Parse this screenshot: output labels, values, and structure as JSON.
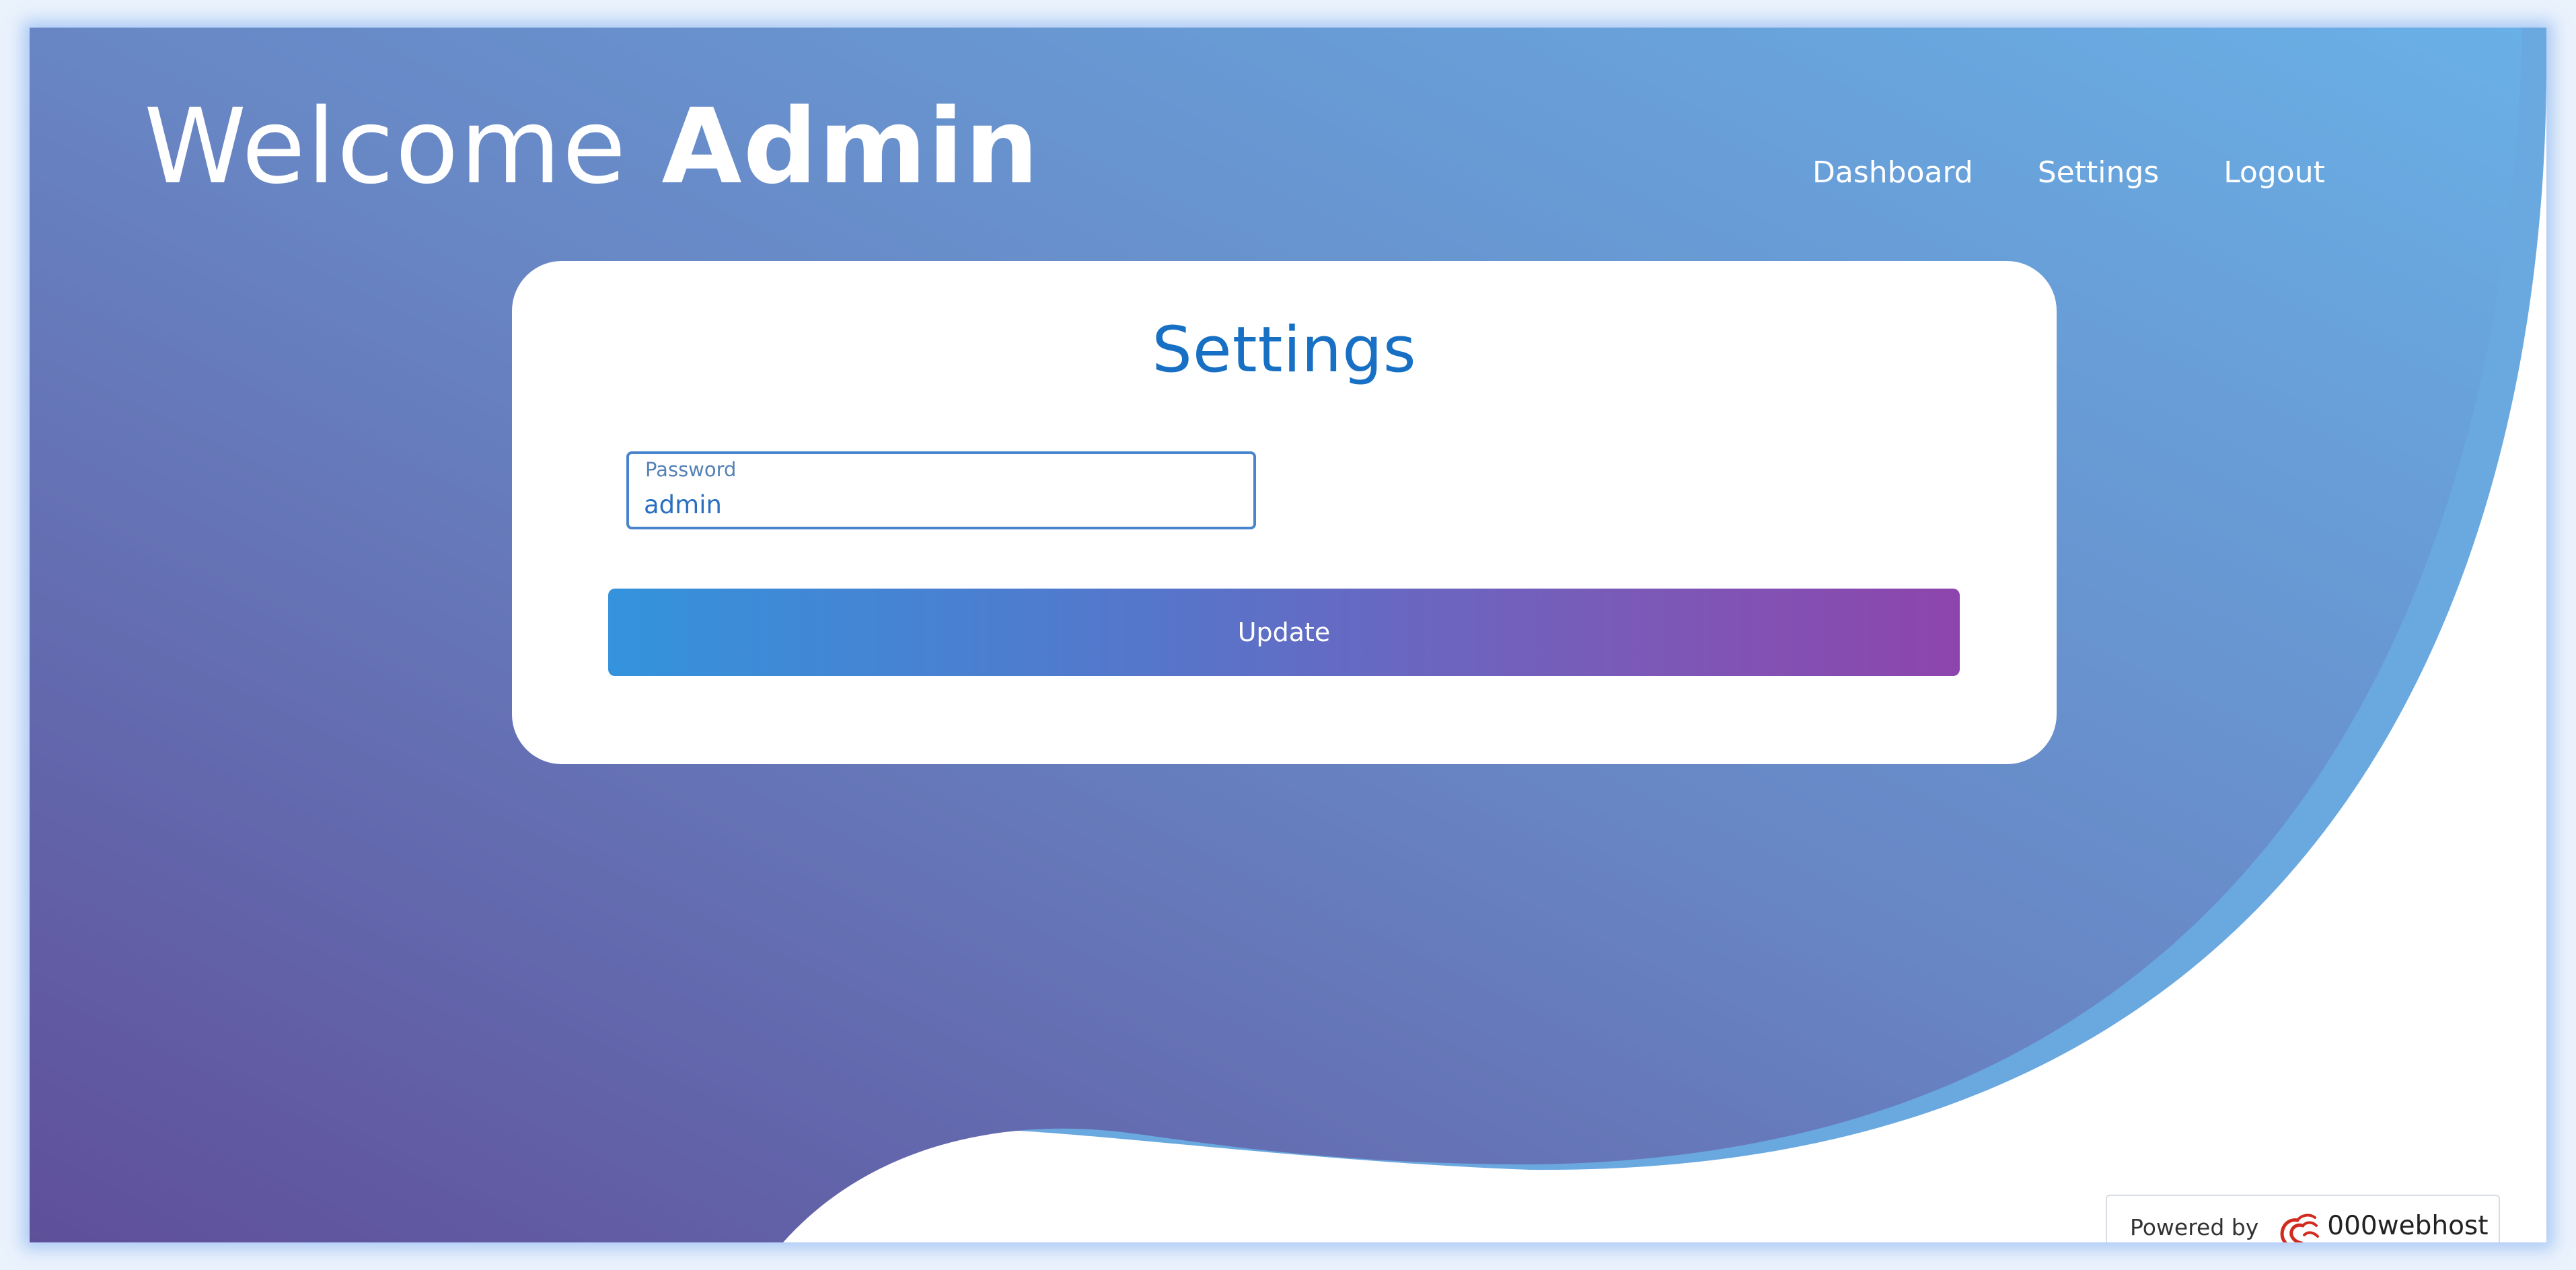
{
  "header": {
    "welcome_prefix": "Welcome",
    "welcome_name": "Admin"
  },
  "nav": {
    "dashboard": "Dashboard",
    "settings": "Settings",
    "logout": "Logout"
  },
  "settings_card": {
    "title": "Settings",
    "password_field": {
      "label": "Password",
      "value": "admin"
    },
    "update_button": "Update"
  },
  "footer_badge": {
    "prefix": "Powered by",
    "brand": "000webhost",
    "icon": "000webhost-logo-icon"
  },
  "colors": {
    "background_gradient_start": "#6556a0",
    "background_gradient_end": "#69ace1",
    "title_blue": "#1770c4",
    "button_gradient_start": "#3493dc",
    "button_gradient_end": "#8d45ad",
    "badge_logo_red": "#d12b20"
  }
}
